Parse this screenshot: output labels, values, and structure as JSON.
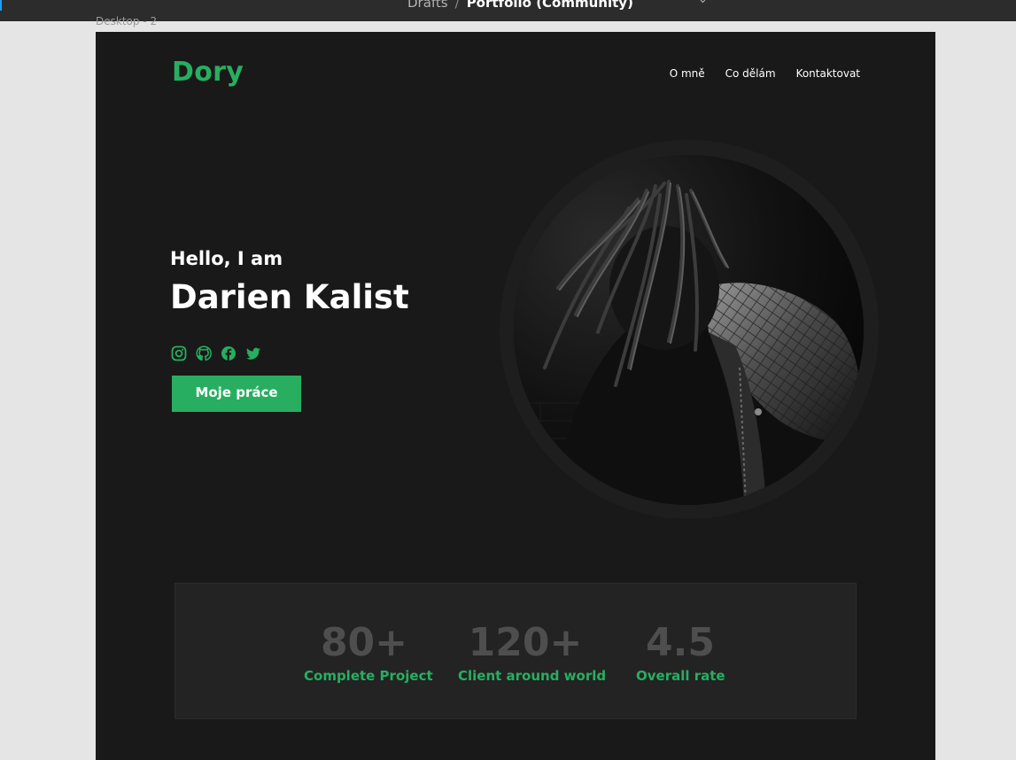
{
  "app_chrome": {
    "breadcrumb_parent": "Drafts",
    "breadcrumb_separator": "/",
    "file_name": "Portfolio (Community)",
    "chevron_icon": "chevron-down-icon",
    "more_icon": "more-icon",
    "frame_label": "Desktop - 2"
  },
  "site": {
    "logo": "Dory",
    "nav": [
      "O mně",
      "Co dělám",
      "Kontaktovat"
    ],
    "hero": {
      "greeting": "Hello, I am",
      "name": "Darien Kalist",
      "socials": [
        "instagram-icon",
        "github-icon",
        "facebook-icon",
        "twitter-icon"
      ],
      "cta_label": "Moje práce"
    },
    "stats": [
      {
        "value": "80+",
        "label": "Complete Project"
      },
      {
        "value": "120+",
        "label": "Client around world"
      },
      {
        "value": "4.5",
        "label": "Overall rate"
      }
    ]
  },
  "colors": {
    "accent": "#27ae60",
    "background": "#191919",
    "panel": "#232323",
    "stat_number": "#4e4e4e"
  }
}
